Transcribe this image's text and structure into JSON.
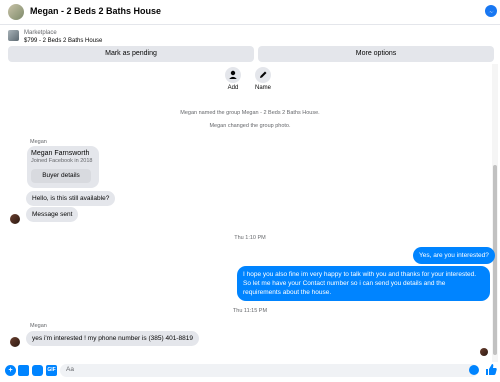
{
  "header": {
    "title": "Megan - 2 Beds 2 Baths House"
  },
  "marketplace": {
    "label": "Marketplace",
    "item": "$799 - 2 Beds 2 Baths House"
  },
  "buttons": {
    "mark_pending": "Mark as pending",
    "more_options": "More options"
  },
  "actions": {
    "add": "Add",
    "name": "Name"
  },
  "system_messages": [
    "Megan named the group Megan - 2 Beds 2 Baths House.",
    "Megan changed the group photo."
  ],
  "profile_card": {
    "sender": "Megan",
    "name": "Megan Farnsworth",
    "joined": "Joined Facebook in 2018",
    "buyer_details": "Buyer details"
  },
  "messages_incoming_1": [
    "Hello, is this still available?",
    "Message sent"
  ],
  "timestamps": [
    "Thu 1:10 PM",
    "Thu 11:15 PM"
  ],
  "messages_outgoing": [
    "Yes, are you interested?",
    "I hope you also fine im very happy to talk with you and thanks for your interested. So let me have your Contact number so i can send you details and the requirements about the house."
  ],
  "incoming_2": {
    "sender": "Megan",
    "text": "yes i'm interested ! my phone number is (385) 401-8819"
  },
  "composer": {
    "placeholder": "Aa"
  },
  "colors": {
    "accent": "#0084ff",
    "bubble_gray": "#e4e6eb",
    "like": "#1877f2"
  },
  "icons": [
    "messenger-icon",
    "person-add-icon",
    "pencil-icon",
    "plus-circle-icon",
    "image-icon",
    "sticker-icon",
    "gif-icon",
    "emoji-icon",
    "thumbs-up-icon"
  ]
}
